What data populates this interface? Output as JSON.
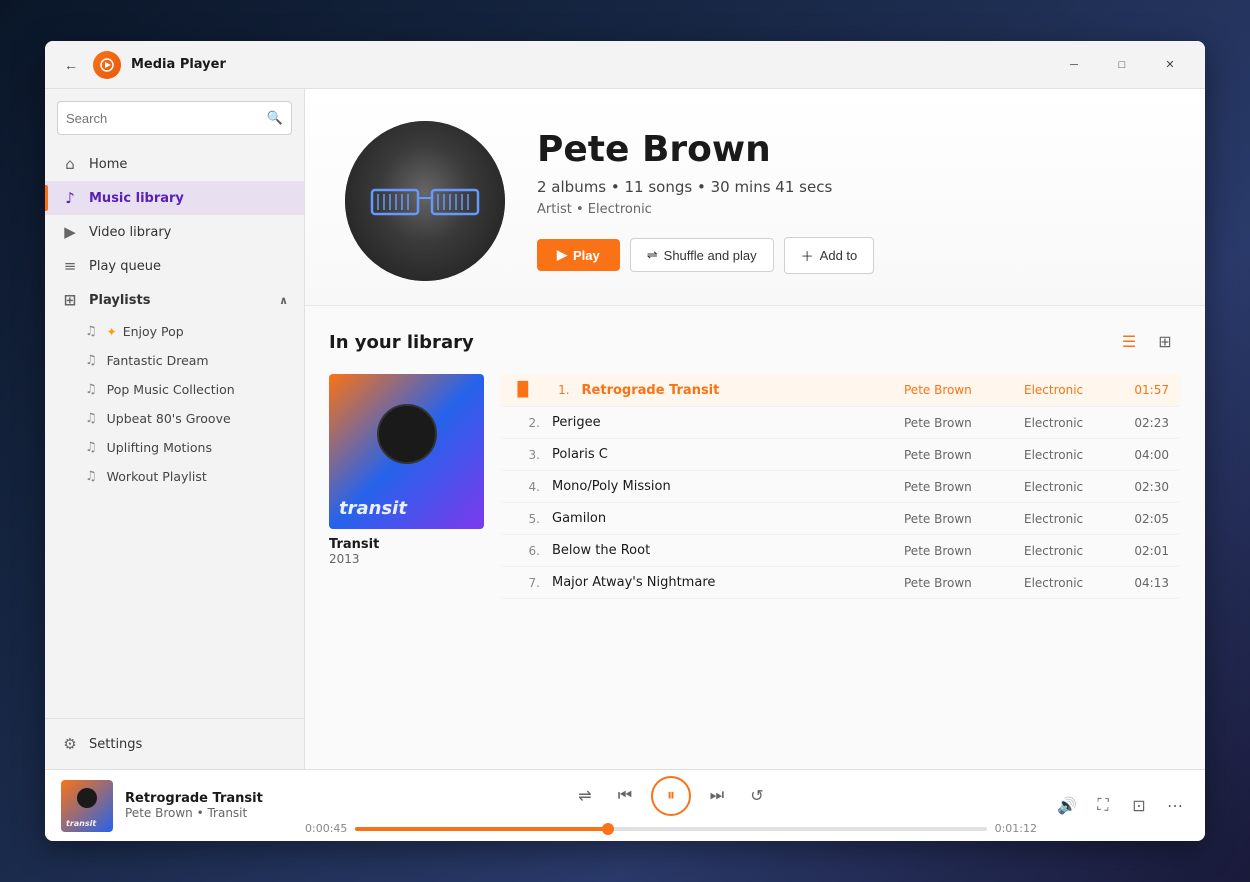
{
  "window": {
    "title": "Media Player"
  },
  "titlebar": {
    "back_label": "←",
    "min_label": "─",
    "max_label": "□",
    "close_label": "✕"
  },
  "sidebar": {
    "search_placeholder": "Search",
    "nav_items": [
      {
        "id": "home",
        "label": "Home",
        "icon": "⌂"
      },
      {
        "id": "music-library",
        "label": "Music library",
        "icon": "♪",
        "active": true
      },
      {
        "id": "video-library",
        "label": "Video library",
        "icon": "▶"
      },
      {
        "id": "play-queue",
        "label": "Play queue",
        "icon": "≡"
      }
    ],
    "playlists_label": "Playlists",
    "playlists": [
      {
        "id": "enjoy-pop",
        "label": "Enjoy Pop",
        "star": true
      },
      {
        "id": "fantastic-dream",
        "label": "Fantastic Dream",
        "star": false
      },
      {
        "id": "pop-music-collection",
        "label": "Pop Music Collection",
        "star": false
      },
      {
        "id": "upbeat-80s",
        "label": "Upbeat 80's Groove",
        "star": false
      },
      {
        "id": "uplifting-motions",
        "label": "Uplifting Motions",
        "star": false
      },
      {
        "id": "workout-playlist",
        "label": "Workout Playlist",
        "star": false
      }
    ],
    "settings_label": "Settings"
  },
  "artist": {
    "name": "Pete Brown",
    "meta": "2 albums • 11 songs • 30 mins 41 secs",
    "genre": "Artist • Electronic",
    "play_label": "Play",
    "shuffle_label": "Shuffle and play",
    "addto_label": "Add to"
  },
  "library": {
    "title": "In your library",
    "album": {
      "name": "Transit",
      "year": "2013"
    },
    "tracks": [
      {
        "num": "1.",
        "name": "Retrograde Transit",
        "artist": "Pete Brown",
        "genre": "Electronic",
        "duration": "01:57",
        "active": true
      },
      {
        "num": "2.",
        "name": "Perigee",
        "artist": "Pete Brown",
        "genre": "Electronic",
        "duration": "02:23",
        "active": false
      },
      {
        "num": "3.",
        "name": "Polaris C",
        "artist": "Pete Brown",
        "genre": "Electronic",
        "duration": "04:00",
        "active": false
      },
      {
        "num": "4.",
        "name": "Mono/Poly Mission",
        "artist": "Pete Brown",
        "genre": "Electronic",
        "duration": "02:30",
        "active": false
      },
      {
        "num": "5.",
        "name": "Gamilon",
        "artist": "Pete Brown",
        "genre": "Electronic",
        "duration": "02:05",
        "active": false
      },
      {
        "num": "6.",
        "name": "Below the Root",
        "artist": "Pete Brown",
        "genre": "Electronic",
        "duration": "02:01",
        "active": false
      },
      {
        "num": "7.",
        "name": "Major Atway's Nightmare",
        "artist": "Pete Brown",
        "genre": "Electronic",
        "duration": "04:13",
        "active": false
      }
    ]
  },
  "nowplaying": {
    "title": "Retrograde Transit",
    "artist_album": "Pete Brown • Transit",
    "time_current": "0:00:45",
    "time_total": "0:01:12",
    "progress_pct": 40
  }
}
